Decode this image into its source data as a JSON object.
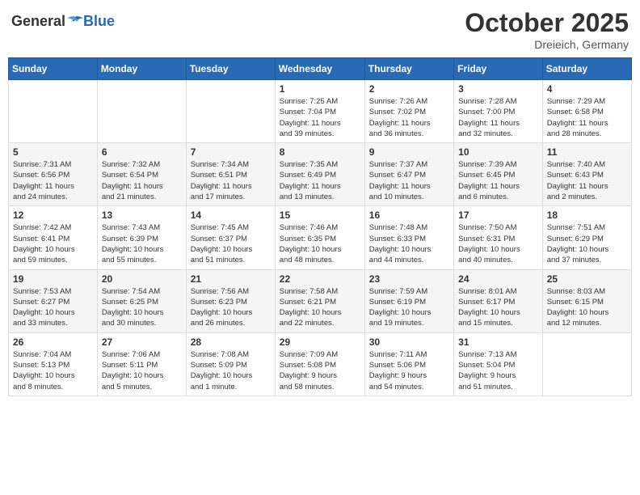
{
  "header": {
    "logo_general": "General",
    "logo_blue": "Blue",
    "month_title": "October 2025",
    "location": "Dreieich, Germany"
  },
  "weekdays": [
    "Sunday",
    "Monday",
    "Tuesday",
    "Wednesday",
    "Thursday",
    "Friday",
    "Saturday"
  ],
  "weeks": [
    [
      {
        "day": "",
        "info": ""
      },
      {
        "day": "",
        "info": ""
      },
      {
        "day": "",
        "info": ""
      },
      {
        "day": "1",
        "info": "Sunrise: 7:25 AM\nSunset: 7:04 PM\nDaylight: 11 hours\nand 39 minutes."
      },
      {
        "day": "2",
        "info": "Sunrise: 7:26 AM\nSunset: 7:02 PM\nDaylight: 11 hours\nand 36 minutes."
      },
      {
        "day": "3",
        "info": "Sunrise: 7:28 AM\nSunset: 7:00 PM\nDaylight: 11 hours\nand 32 minutes."
      },
      {
        "day": "4",
        "info": "Sunrise: 7:29 AM\nSunset: 6:58 PM\nDaylight: 11 hours\nand 28 minutes."
      }
    ],
    [
      {
        "day": "5",
        "info": "Sunrise: 7:31 AM\nSunset: 6:56 PM\nDaylight: 11 hours\nand 24 minutes."
      },
      {
        "day": "6",
        "info": "Sunrise: 7:32 AM\nSunset: 6:54 PM\nDaylight: 11 hours\nand 21 minutes."
      },
      {
        "day": "7",
        "info": "Sunrise: 7:34 AM\nSunset: 6:51 PM\nDaylight: 11 hours\nand 17 minutes."
      },
      {
        "day": "8",
        "info": "Sunrise: 7:35 AM\nSunset: 6:49 PM\nDaylight: 11 hours\nand 13 minutes."
      },
      {
        "day": "9",
        "info": "Sunrise: 7:37 AM\nSunset: 6:47 PM\nDaylight: 11 hours\nand 10 minutes."
      },
      {
        "day": "10",
        "info": "Sunrise: 7:39 AM\nSunset: 6:45 PM\nDaylight: 11 hours\nand 6 minutes."
      },
      {
        "day": "11",
        "info": "Sunrise: 7:40 AM\nSunset: 6:43 PM\nDaylight: 11 hours\nand 2 minutes."
      }
    ],
    [
      {
        "day": "12",
        "info": "Sunrise: 7:42 AM\nSunset: 6:41 PM\nDaylight: 10 hours\nand 59 minutes."
      },
      {
        "day": "13",
        "info": "Sunrise: 7:43 AM\nSunset: 6:39 PM\nDaylight: 10 hours\nand 55 minutes."
      },
      {
        "day": "14",
        "info": "Sunrise: 7:45 AM\nSunset: 6:37 PM\nDaylight: 10 hours\nand 51 minutes."
      },
      {
        "day": "15",
        "info": "Sunrise: 7:46 AM\nSunset: 6:35 PM\nDaylight: 10 hours\nand 48 minutes."
      },
      {
        "day": "16",
        "info": "Sunrise: 7:48 AM\nSunset: 6:33 PM\nDaylight: 10 hours\nand 44 minutes."
      },
      {
        "day": "17",
        "info": "Sunrise: 7:50 AM\nSunset: 6:31 PM\nDaylight: 10 hours\nand 40 minutes."
      },
      {
        "day": "18",
        "info": "Sunrise: 7:51 AM\nSunset: 6:29 PM\nDaylight: 10 hours\nand 37 minutes."
      }
    ],
    [
      {
        "day": "19",
        "info": "Sunrise: 7:53 AM\nSunset: 6:27 PM\nDaylight: 10 hours\nand 33 minutes."
      },
      {
        "day": "20",
        "info": "Sunrise: 7:54 AM\nSunset: 6:25 PM\nDaylight: 10 hours\nand 30 minutes."
      },
      {
        "day": "21",
        "info": "Sunrise: 7:56 AM\nSunset: 6:23 PM\nDaylight: 10 hours\nand 26 minutes."
      },
      {
        "day": "22",
        "info": "Sunrise: 7:58 AM\nSunset: 6:21 PM\nDaylight: 10 hours\nand 22 minutes."
      },
      {
        "day": "23",
        "info": "Sunrise: 7:59 AM\nSunset: 6:19 PM\nDaylight: 10 hours\nand 19 minutes."
      },
      {
        "day": "24",
        "info": "Sunrise: 8:01 AM\nSunset: 6:17 PM\nDaylight: 10 hours\nand 15 minutes."
      },
      {
        "day": "25",
        "info": "Sunrise: 8:03 AM\nSunset: 6:15 PM\nDaylight: 10 hours\nand 12 minutes."
      }
    ],
    [
      {
        "day": "26",
        "info": "Sunrise: 7:04 AM\nSunset: 5:13 PM\nDaylight: 10 hours\nand 8 minutes."
      },
      {
        "day": "27",
        "info": "Sunrise: 7:06 AM\nSunset: 5:11 PM\nDaylight: 10 hours\nand 5 minutes."
      },
      {
        "day": "28",
        "info": "Sunrise: 7:08 AM\nSunset: 5:09 PM\nDaylight: 10 hours\nand 1 minute."
      },
      {
        "day": "29",
        "info": "Sunrise: 7:09 AM\nSunset: 5:08 PM\nDaylight: 9 hours\nand 58 minutes."
      },
      {
        "day": "30",
        "info": "Sunrise: 7:11 AM\nSunset: 5:06 PM\nDaylight: 9 hours\nand 54 minutes."
      },
      {
        "day": "31",
        "info": "Sunrise: 7:13 AM\nSunset: 5:04 PM\nDaylight: 9 hours\nand 51 minutes."
      },
      {
        "day": "",
        "info": ""
      }
    ]
  ]
}
